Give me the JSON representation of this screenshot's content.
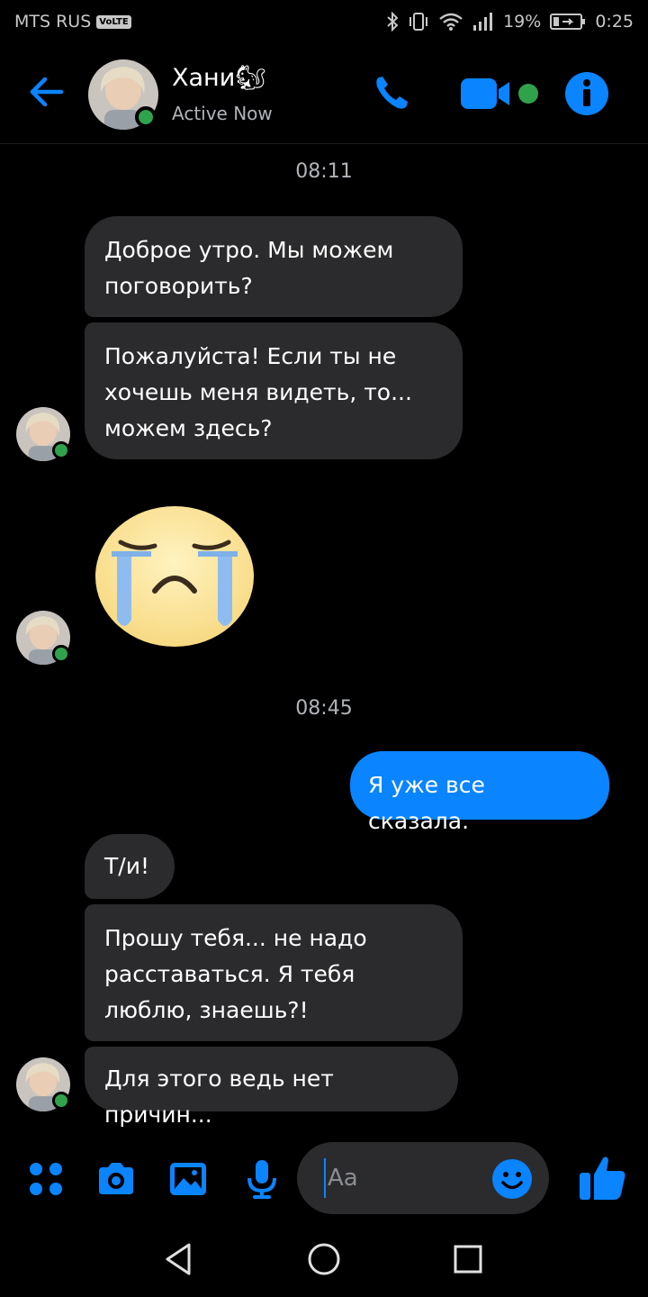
{
  "status_bar": {
    "carrier": "MTS RUS",
    "volte": "VoLTE",
    "battery": "19%",
    "time": "0:25"
  },
  "header": {
    "contact_name": "Хани🐿",
    "contact_status": "Active Now"
  },
  "conversation": {
    "timestamp_1": "08:11",
    "msg_1": "Доброе утро. Мы можем поговорить?",
    "msg_2": "Пожалуйста! Если ты не хочешь меня видеть, то... можем здесь?",
    "timestamp_2": "08:45",
    "msg_3_outgoing": "Я уже все сказала.",
    "msg_4": "Т/и!",
    "msg_5": "Прошу тебя... не надо расставаться. Я тебя люблю, знаешь?!",
    "msg_6": "Для этого ведь нет причин..."
  },
  "composer": {
    "placeholder": "Aa"
  },
  "colors": {
    "accent": "#0a84ff",
    "online": "#31a24c",
    "incoming_bubble": "#2b2b2d",
    "background": "#000000"
  },
  "icons": [
    "back-arrow-icon",
    "phone-icon",
    "video-camera-icon",
    "info-icon",
    "menu-dots-icon",
    "camera-icon",
    "gallery-icon",
    "microphone-icon",
    "emoji-icon",
    "thumbs-up-icon",
    "nav-back-icon",
    "nav-home-icon",
    "nav-recents-icon",
    "sad-face-sticker"
  ]
}
